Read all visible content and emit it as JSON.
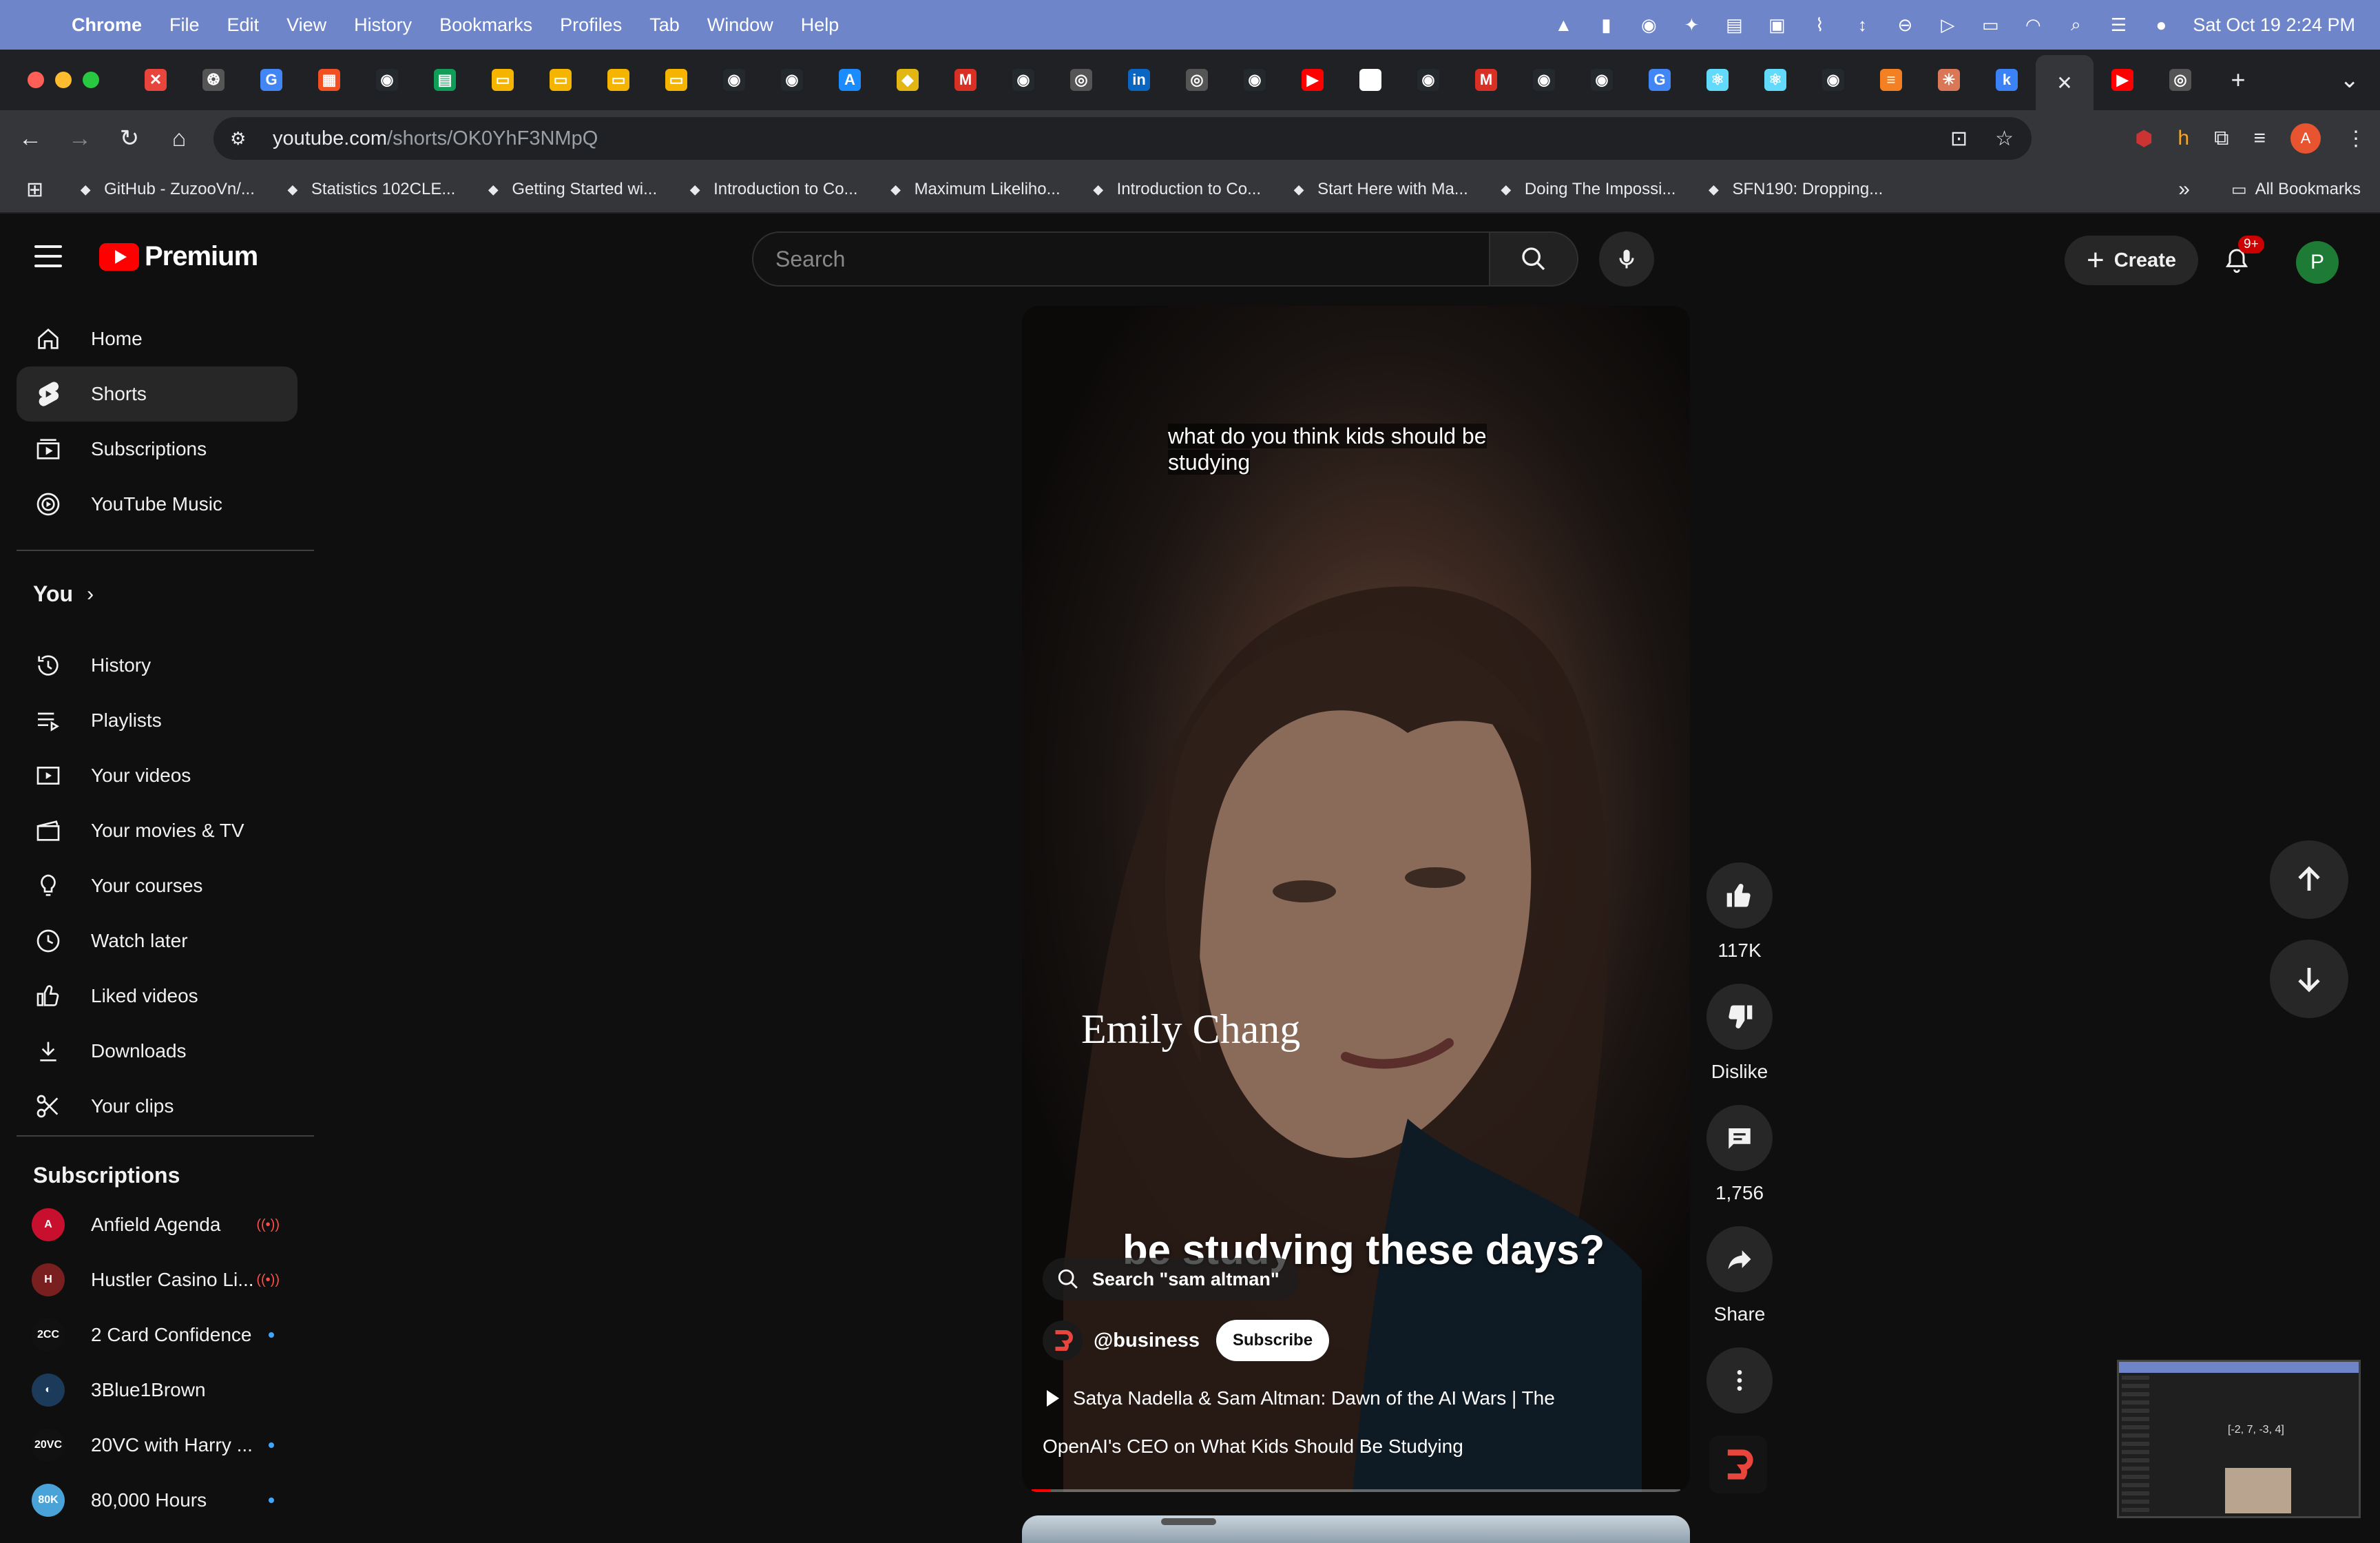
{
  "menubar": {
    "app": "Chrome",
    "items": [
      "File",
      "Edit",
      "View",
      "History",
      "Bookmarks",
      "Profiles",
      "Tab",
      "Window",
      "Help"
    ],
    "datetime": "Sat Oct 19  2:24 PM"
  },
  "tabs": {
    "favicons": [
      {
        "icon": "x-icon",
        "glyph": "✕",
        "color": "#e8453c"
      },
      {
        "icon": "openai-icon",
        "glyph": "❂",
        "color": "#555"
      },
      {
        "icon": "google-icon",
        "glyph": "G",
        "color": "#4285f4"
      },
      {
        "icon": "microsoft-icon",
        "glyph": "▦",
        "color": "#f25022"
      },
      {
        "icon": "github-icon",
        "glyph": "◉",
        "color": "#24292e"
      },
      {
        "icon": "sheets-icon",
        "glyph": "▤",
        "color": "#0f9d58"
      },
      {
        "icon": "slides-icon",
        "glyph": "▭",
        "color": "#f4b400"
      },
      {
        "icon": "slides-icon",
        "glyph": "▭",
        "color": "#f4b400"
      },
      {
        "icon": "slides-icon",
        "glyph": "▭",
        "color": "#f4b400"
      },
      {
        "icon": "slides-icon",
        "glyph": "▭",
        "color": "#f4b400"
      },
      {
        "icon": "github-icon",
        "glyph": "◉",
        "color": "#24292e"
      },
      {
        "icon": "github-icon",
        "glyph": "◉",
        "color": "#24292e"
      },
      {
        "icon": "appstore-icon",
        "glyph": "A",
        "color": "#1a8cff"
      },
      {
        "icon": "coursera-icon",
        "glyph": "◆",
        "color": "#e2b714"
      },
      {
        "icon": "gmail-icon",
        "glyph": "M",
        "color": "#d93025"
      },
      {
        "icon": "github-icon",
        "glyph": "◉",
        "color": "#24292e"
      },
      {
        "icon": "chrome-icon",
        "glyph": "◎",
        "color": "#555"
      },
      {
        "icon": "linkedin-icon",
        "glyph": "in",
        "color": "#0a66c2"
      },
      {
        "icon": "chrome-icon",
        "glyph": "◎",
        "color": "#555"
      },
      {
        "icon": "github-icon",
        "glyph": "◉",
        "color": "#24292e"
      },
      {
        "icon": "youtube-icon",
        "glyph": "▶",
        "color": "#ff0000"
      },
      {
        "icon": "dots-app-icon",
        "glyph": "▪",
        "color": "#fff"
      },
      {
        "icon": "github-icon",
        "glyph": "◉",
        "color": "#24292e"
      },
      {
        "icon": "gmail-icon",
        "glyph": "M",
        "color": "#d93025"
      },
      {
        "icon": "github-icon",
        "glyph": "◉",
        "color": "#24292e"
      },
      {
        "icon": "github-icon",
        "glyph": "◉",
        "color": "#24292e"
      },
      {
        "icon": "google-icon",
        "glyph": "G",
        "color": "#4285f4"
      },
      {
        "icon": "react-icon",
        "glyph": "⚛",
        "color": "#61dafb"
      },
      {
        "icon": "react-icon",
        "glyph": "⚛",
        "color": "#61dafb"
      },
      {
        "icon": "github-icon",
        "glyph": "◉",
        "color": "#24292e"
      },
      {
        "icon": "stackoverflow-icon",
        "glyph": "≡",
        "color": "#f48024"
      },
      {
        "icon": "claude-icon",
        "glyph": "✳",
        "color": "#d97757"
      },
      {
        "icon": "k-icon",
        "glyph": "k",
        "color": "#3b82f6"
      }
    ],
    "active_close": "✕",
    "after_active": [
      {
        "icon": "youtube-icon",
        "glyph": "▶",
        "color": "#ff0000"
      },
      {
        "icon": "chrome-icon",
        "glyph": "◎",
        "color": "#555"
      }
    ],
    "new_tab": "+",
    "tab_search": "⌄"
  },
  "toolbar": {
    "url_host": "youtube.com",
    "url_path": "/shorts/OK0YhF3NMpQ"
  },
  "bookmarks": {
    "items": [
      {
        "icon": "github-icon",
        "label": "GitHub - ZuzooVn/..."
      },
      {
        "icon": "bclb-icon",
        "label": "Statistics 102CLE..."
      },
      {
        "icon": "dots-icon",
        "label": "Getting Started wi..."
      },
      {
        "icon": "bars-icon",
        "label": "Introduction to Co..."
      },
      {
        "icon": "doc-icon",
        "label": "Maximum Likeliho..."
      },
      {
        "icon": "bars-icon",
        "label": "Introduction to Co..."
      },
      {
        "icon": "image-icon",
        "label": "Start Here with Ma..."
      },
      {
        "icon": "globe-icon",
        "label": "Doing The Impossi..."
      },
      {
        "icon": "f-icon",
        "label": "SFN190: Dropping..."
      }
    ],
    "overflow": "»",
    "all_bookmarks": "All Bookmarks"
  },
  "masthead": {
    "brand": "Premium",
    "search_placeholder": "Search",
    "create_label": "Create",
    "notification_badge": "9+",
    "avatar_initial": "P"
  },
  "sidebar": {
    "main": [
      {
        "name": "home",
        "label": "Home"
      },
      {
        "name": "shorts",
        "label": "Shorts"
      },
      {
        "name": "subscriptions",
        "label": "Subscriptions"
      },
      {
        "name": "youtube-music",
        "label": "YouTube Music"
      }
    ],
    "you_heading": "You",
    "you": [
      {
        "name": "history",
        "label": "History"
      },
      {
        "name": "playlists",
        "label": "Playlists"
      },
      {
        "name": "your-videos",
        "label": "Your videos"
      },
      {
        "name": "your-movies",
        "label": "Your movies & TV"
      },
      {
        "name": "your-courses",
        "label": "Your courses"
      },
      {
        "name": "watch-later",
        "label": "Watch later"
      },
      {
        "name": "liked-videos",
        "label": "Liked videos"
      },
      {
        "name": "downloads",
        "label": "Downloads"
      },
      {
        "name": "your-clips",
        "label": "Your clips"
      }
    ],
    "subs_heading": "Subscriptions",
    "subs": [
      {
        "name": "anfield-agenda",
        "label": "Anfield Agenda",
        "status": "live",
        "avatar_color": "#c8102e",
        "avatar_text": "A"
      },
      {
        "name": "hustler-casino",
        "label": "Hustler Casino Li...",
        "status": "live",
        "avatar_color": "#7a1f1f",
        "avatar_text": "H"
      },
      {
        "name": "2-card-confidence",
        "label": "2 Card Confidence",
        "status": "new",
        "avatar_color": "#111",
        "avatar_text": "2CC"
      },
      {
        "name": "3blue1brown",
        "label": "3Blue1Brown",
        "status": "none",
        "avatar_color": "#1c3a5a",
        "avatar_text": "◐"
      },
      {
        "name": "20vc",
        "label": "20VC with Harry ...",
        "status": "new",
        "avatar_color": "#111",
        "avatar_text": "20VC"
      },
      {
        "name": "80000-hours",
        "label": "80,000 Hours",
        "status": "new",
        "avatar_color": "#4aa3d8",
        "avatar_text": "80K"
      }
    ]
  },
  "short": {
    "caption_top": "what do you think kids should be studying",
    "name_overlay": "Emily Chang",
    "caption_big": "be studying these days?",
    "search_chip": "Search \"sam altman\"",
    "channel": "@business",
    "subscribe_label": "Subscribe",
    "related_video": "Satya Nadella & Sam Altman: Dawn of the AI Wars | The",
    "title": "OpenAI's CEO on What Kids Should Be Studying",
    "progress": 0.03
  },
  "actions": {
    "likes": "117K",
    "dislike_label": "Dislike",
    "comments": "1,756",
    "share_label": "Share"
  },
  "mini": {
    "text": "[-2, 7, -3, 4]"
  },
  "colors": {
    "accent_red": "#ff0000",
    "brand_blue": "#3ea6ff",
    "live_red": "#ff4e45"
  }
}
